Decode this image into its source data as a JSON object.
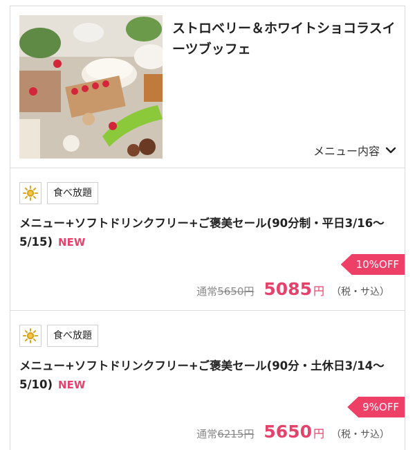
{
  "buffet": {
    "title": "ストロベリー＆ホワイトショコラスイーツブッフェ",
    "menu_toggle_label": "メニュー内容",
    "photo_alt": "strawberry sweets buffet photo"
  },
  "plans": [
    {
      "icon": "sun-icon",
      "tag": "食べ放題",
      "name": "メニュー+ソフトドリンクフリー+ご褒美セール(90分制・平日3/16〜5/15)",
      "badge": "NEW",
      "discount": "10%OFF",
      "normal_label": "通常",
      "normal_price": "5650",
      "normal_yen": "円",
      "sale_price": "5085",
      "sale_yen": "円",
      "tax_note": "（税・サ込）"
    },
    {
      "icon": "sun-icon",
      "tag": "食べ放題",
      "name": "メニュー+ソフトドリンクフリー+ご褒美セール(90分・土休日3/14〜5/10)",
      "badge": "NEW",
      "discount": "9%OFF",
      "normal_label": "通常",
      "normal_price": "6215",
      "normal_yen": "円",
      "sale_price": "5650",
      "sale_yen": "円",
      "tax_note": "（税・サ込）"
    }
  ],
  "colors": {
    "accent": "#e5436b",
    "ribbon": "#ee3f67",
    "sun": "#d9a31c"
  }
}
